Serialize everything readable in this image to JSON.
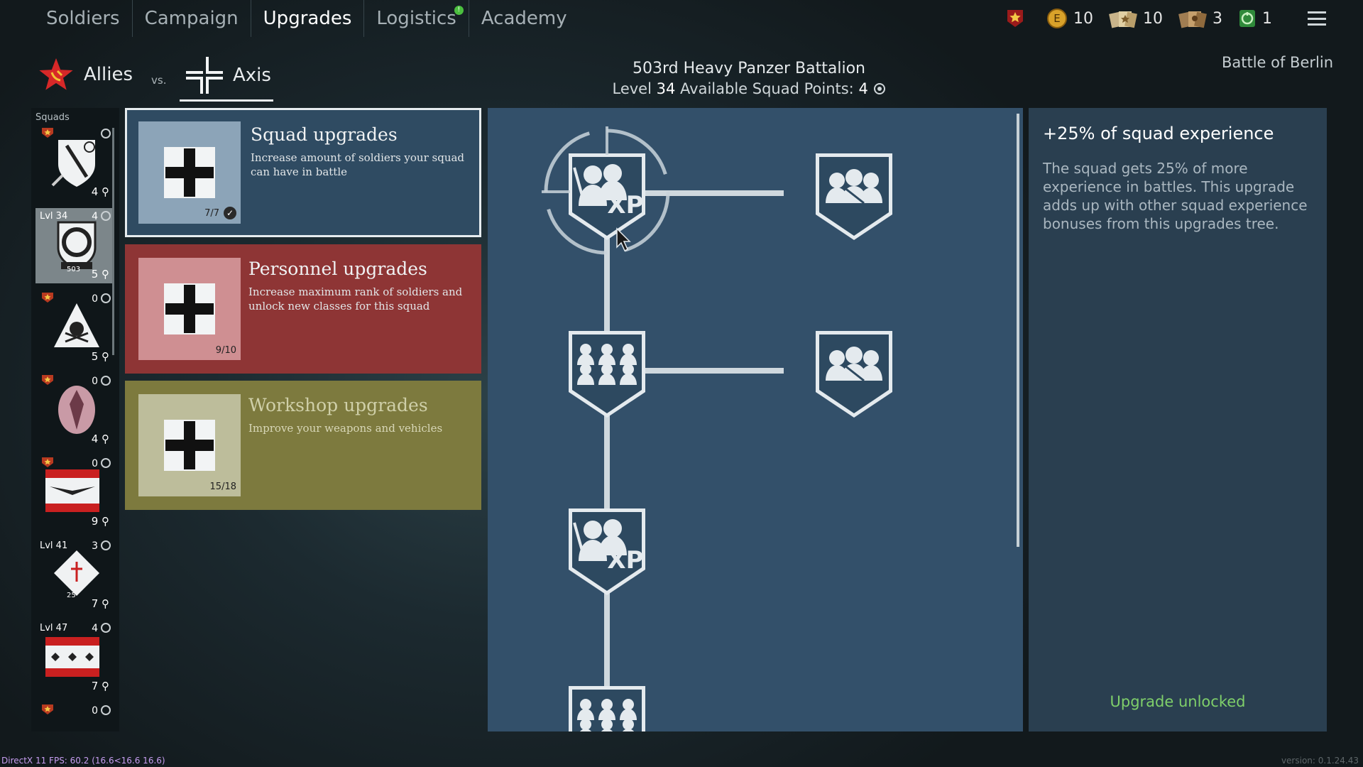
{
  "nav": {
    "tabs": [
      {
        "label": "Soldiers",
        "active": false
      },
      {
        "label": "Campaign",
        "active": false
      },
      {
        "label": "Upgrades",
        "active": true
      },
      {
        "label": "Logistics",
        "active": false,
        "notification": "!"
      },
      {
        "label": "Academy",
        "active": false
      }
    ]
  },
  "resources": {
    "gold_coins": "10",
    "silver_orders": "10",
    "bronze_orders": "3",
    "boosters": "1"
  },
  "factions": {
    "allies": "Allies",
    "vs": "vs.",
    "axis": "Axis"
  },
  "battalion": {
    "name": "503rd Heavy Panzer Battalion",
    "level_label": "Level",
    "level": "34",
    "points_label": "Available Squad Points:",
    "points": "4"
  },
  "battle": "Battle of Berlin",
  "squads": {
    "label": "Squads",
    "items": [
      {
        "lvl": "",
        "points": "",
        "count": "4",
        "active": false
      },
      {
        "lvl": "Lvl 34",
        "points": "4",
        "count": "5",
        "tag": "503",
        "active": true
      },
      {
        "lvl": "",
        "points": "0",
        "count": "5",
        "active": false
      },
      {
        "lvl": "",
        "points": "0",
        "count": "4",
        "active": false
      },
      {
        "lvl": "",
        "points": "0",
        "count": "9",
        "active": false
      },
      {
        "lvl": "Lvl 41",
        "points": "3",
        "count": "7",
        "tag": "25",
        "active": false
      },
      {
        "lvl": "Lvl 47",
        "points": "4",
        "count": "7",
        "active": false
      },
      {
        "lvl": "",
        "points": "0",
        "count": "",
        "active": false
      }
    ]
  },
  "categories": {
    "squad": {
      "title": "Squad upgrades",
      "desc": "Increase amount of soldiers your squad can have in battle",
      "progress": "7/7"
    },
    "personnel": {
      "title": "Personnel upgrades",
      "desc": "Increase maximum rank of soldiers and unlock new classes for this squad",
      "progress": "9/10"
    },
    "workshop": {
      "title": "Workshop upgrades",
      "desc": "Improve your weapons and vehicles",
      "progress": "15/18"
    }
  },
  "tree": {
    "xp_label": "XP"
  },
  "detail": {
    "title": "+25% of squad experience",
    "desc": "The squad gets 25% of more experience in battles. This upgrade adds up with other squad experience bonuses from this upgrades tree.",
    "status": "Upgrade unlocked"
  },
  "footer": {
    "fps": "DirectX 11 FPS: 60.2 (16.6<16.6 16.6)",
    "version": "version: 0.1.24.43"
  },
  "colors": {
    "squad_bg": "#2f4b62",
    "personnel_bg": "#8e3535",
    "workshop_bg": "#7d7a3e",
    "tree_bg": "#33506a",
    "unlocked": "#7fcf6a"
  }
}
